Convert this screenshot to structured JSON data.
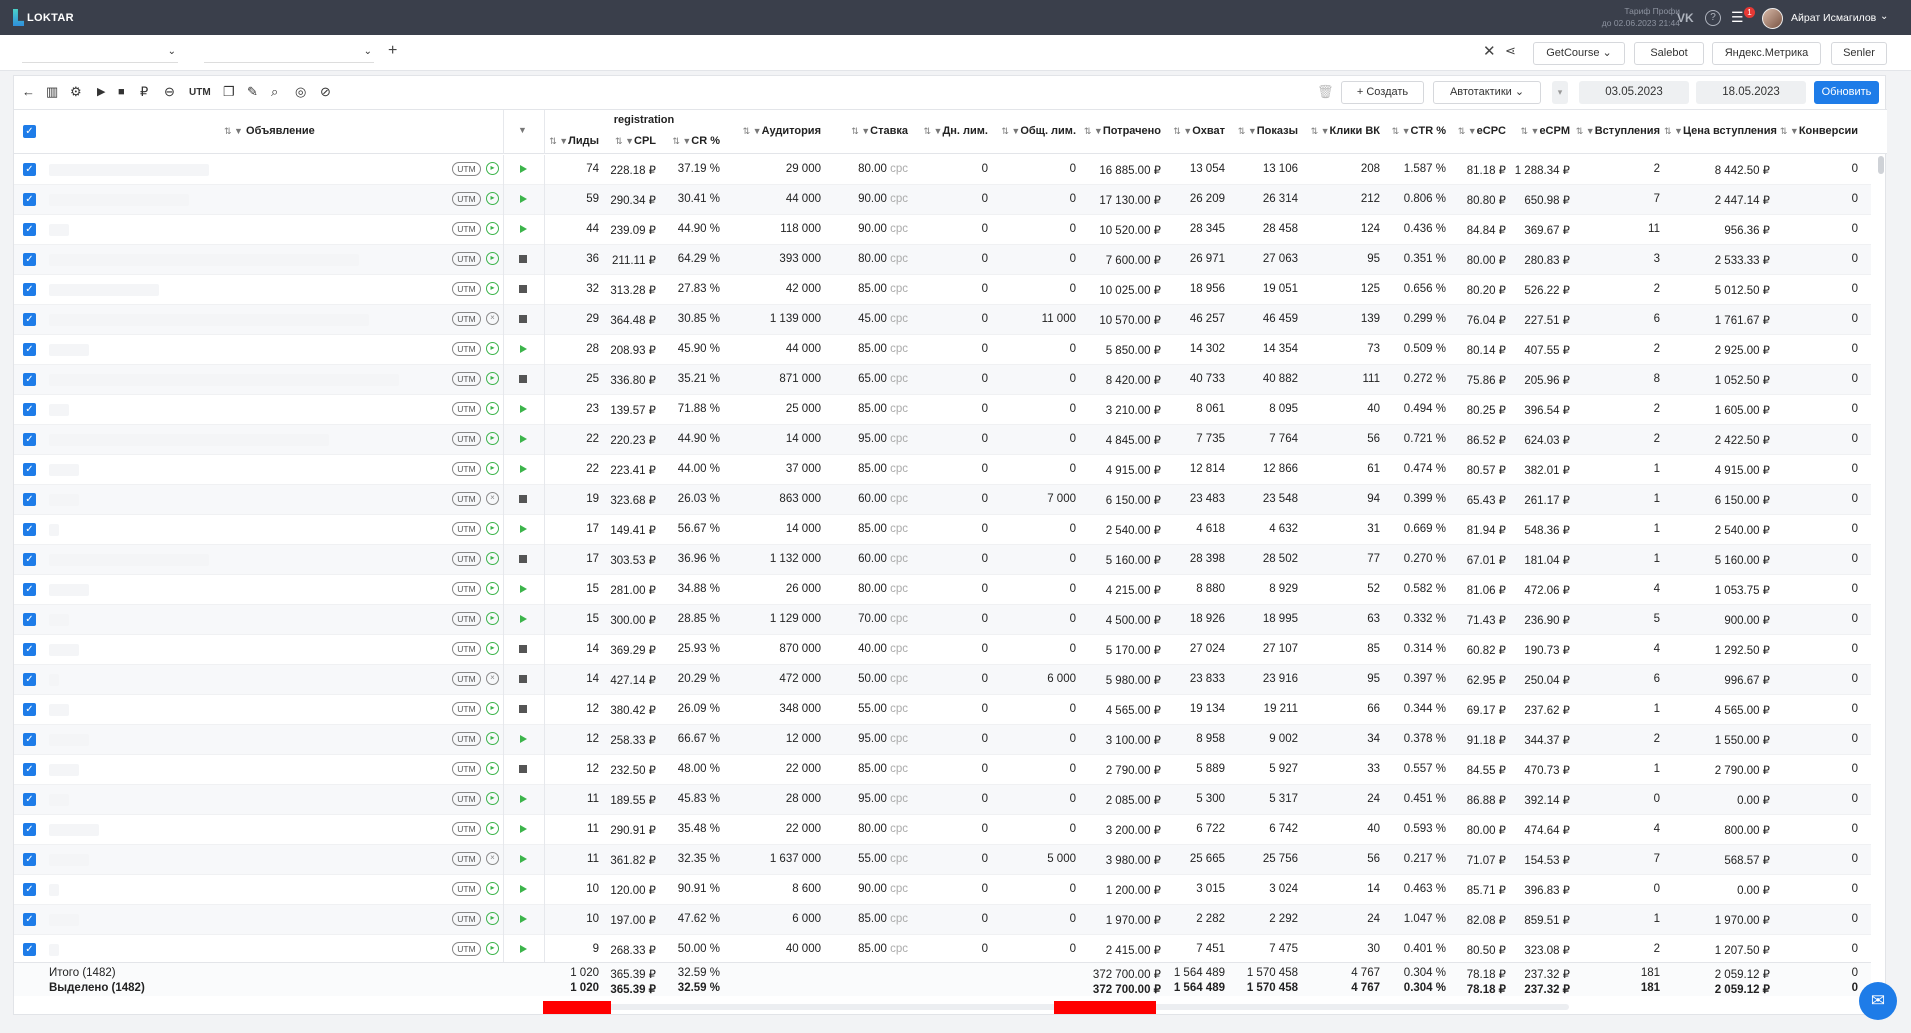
{
  "brand": {
    "logo_text": "LOKTAR"
  },
  "top": {
    "tariff_line1": "Тариф Профи",
    "tariff_line2": "до 02.06.2023 21:44",
    "notif_count": "1",
    "username": "Айрат Исмагилов"
  },
  "integrations": [
    "GetCourse",
    "Salebot",
    "Яндекс.Метрика",
    "Senler"
  ],
  "toolbar": {
    "utm_label": "UTM",
    "create_label": "Создать",
    "autotactics_label": "Автотактики",
    "date_from": "03.05.2023",
    "date_to": "18.05.2023",
    "refresh_label": "Обновить"
  },
  "columns": {
    "ad": "Объявление",
    "group": "registration",
    "leads": "Лиды",
    "cpl": "CPL",
    "cr": "CR %",
    "audience": "Аудитория",
    "rate": "Ставка",
    "day_lim": "Дн. лим.",
    "total_lim": "Общ. лим.",
    "spent": "Потрачено",
    "reach": "Охват",
    "impressions": "Показы",
    "clicks": "Клики ВК",
    "ctr": "CTR %",
    "ecpc": "eCPC",
    "ecpm": "eCPM",
    "joins": "Вступления",
    "join_price": "Цена вступления",
    "conv": "Конверсии"
  },
  "rows": [
    {
      "status": "on",
      "run": "play",
      "leads": "74",
      "cpl": "228.18 ₽",
      "cr": "37.19 %",
      "audience": "29 000",
      "rate": "80.00",
      "day_lim": "0",
      "total_lim": "0",
      "spent": "16 885.00 ₽",
      "reach": "13 054",
      "impressions": "13 106",
      "clicks": "208",
      "ctr": "1.587 %",
      "ecpc": "81.18 ₽",
      "ecpm": "1 288.34 ₽",
      "joins": "2",
      "join_price": "8 442.50 ₽",
      "conv": "0"
    },
    {
      "status": "on",
      "run": "play",
      "leads": "59",
      "cpl": "290.34 ₽",
      "cr": "30.41 %",
      "audience": "44 000",
      "rate": "90.00",
      "day_lim": "0",
      "total_lim": "0",
      "spent": "17 130.00 ₽",
      "reach": "26 209",
      "impressions": "26 314",
      "clicks": "212",
      "ctr": "0.806 %",
      "ecpc": "80.80 ₽",
      "ecpm": "650.98 ₽",
      "joins": "7",
      "join_price": "2 447.14 ₽",
      "conv": "0"
    },
    {
      "status": "on",
      "run": "play",
      "leads": "44",
      "cpl": "239.09 ₽",
      "cr": "44.90 %",
      "audience": "118 000",
      "rate": "90.00",
      "day_lim": "0",
      "total_lim": "0",
      "spent": "10 520.00 ₽",
      "reach": "28 345",
      "impressions": "28 458",
      "clicks": "124",
      "ctr": "0.436 %",
      "ecpc": "84.84 ₽",
      "ecpm": "369.67 ₽",
      "joins": "11",
      "join_price": "956.36 ₽",
      "conv": "0"
    },
    {
      "status": "on",
      "run": "stop",
      "leads": "36",
      "cpl": "211.11 ₽",
      "cr": "64.29 %",
      "audience": "393 000",
      "rate": "80.00",
      "day_lim": "0",
      "total_lim": "0",
      "spent": "7 600.00 ₽",
      "reach": "26 971",
      "impressions": "27 063",
      "clicks": "95",
      "ctr": "0.351 %",
      "ecpc": "80.00 ₽",
      "ecpm": "280.83 ₽",
      "joins": "3",
      "join_price": "2 533.33 ₽",
      "conv": "0"
    },
    {
      "status": "on",
      "run": "stop",
      "leads": "32",
      "cpl": "313.28 ₽",
      "cr": "27.83 %",
      "audience": "42 000",
      "rate": "85.00",
      "day_lim": "0",
      "total_lim": "0",
      "spent": "10 025.00 ₽",
      "reach": "18 956",
      "impressions": "19 051",
      "clicks": "125",
      "ctr": "0.656 %",
      "ecpc": "80.20 ₽",
      "ecpm": "526.22 ₽",
      "joins": "2",
      "join_price": "5 012.50 ₽",
      "conv": "0"
    },
    {
      "status": "off",
      "run": "stop",
      "leads": "29",
      "cpl": "364.48 ₽",
      "cr": "30.85 %",
      "audience": "1 139 000",
      "rate": "45.00",
      "day_lim": "0",
      "total_lim": "11 000",
      "spent": "10 570.00 ₽",
      "reach": "46 257",
      "impressions": "46 459",
      "clicks": "139",
      "ctr": "0.299 %",
      "ecpc": "76.04 ₽",
      "ecpm": "227.51 ₽",
      "joins": "6",
      "join_price": "1 761.67 ₽",
      "conv": "0"
    },
    {
      "status": "on",
      "run": "play",
      "leads": "28",
      "cpl": "208.93 ₽",
      "cr": "45.90 %",
      "audience": "44 000",
      "rate": "85.00",
      "day_lim": "0",
      "total_lim": "0",
      "spent": "5 850.00 ₽",
      "reach": "14 302",
      "impressions": "14 354",
      "clicks": "73",
      "ctr": "0.509 %",
      "ecpc": "80.14 ₽",
      "ecpm": "407.55 ₽",
      "joins": "2",
      "join_price": "2 925.00 ₽",
      "conv": "0"
    },
    {
      "status": "on",
      "run": "stop",
      "leads": "25",
      "cpl": "336.80 ₽",
      "cr": "35.21 %",
      "audience": "871 000",
      "rate": "65.00",
      "day_lim": "0",
      "total_lim": "0",
      "spent": "8 420.00 ₽",
      "reach": "40 733",
      "impressions": "40 882",
      "clicks": "111",
      "ctr": "0.272 %",
      "ecpc": "75.86 ₽",
      "ecpm": "205.96 ₽",
      "joins": "8",
      "join_price": "1 052.50 ₽",
      "conv": "0"
    },
    {
      "status": "on",
      "run": "play",
      "leads": "23",
      "cpl": "139.57 ₽",
      "cr": "71.88 %",
      "audience": "25 000",
      "rate": "85.00",
      "day_lim": "0",
      "total_lim": "0",
      "spent": "3 210.00 ₽",
      "reach": "8 061",
      "impressions": "8 095",
      "clicks": "40",
      "ctr": "0.494 %",
      "ecpc": "80.25 ₽",
      "ecpm": "396.54 ₽",
      "joins": "2",
      "join_price": "1 605.00 ₽",
      "conv": "0"
    },
    {
      "status": "on",
      "run": "play",
      "leads": "22",
      "cpl": "220.23 ₽",
      "cr": "44.90 %",
      "audience": "14 000",
      "rate": "95.00",
      "day_lim": "0",
      "total_lim": "0",
      "spent": "4 845.00 ₽",
      "reach": "7 735",
      "impressions": "7 764",
      "clicks": "56",
      "ctr": "0.721 %",
      "ecpc": "86.52 ₽",
      "ecpm": "624.03 ₽",
      "joins": "2",
      "join_price": "2 422.50 ₽",
      "conv": "0"
    },
    {
      "status": "on",
      "run": "play",
      "leads": "22",
      "cpl": "223.41 ₽",
      "cr": "44.00 %",
      "audience": "37 000",
      "rate": "85.00",
      "day_lim": "0",
      "total_lim": "0",
      "spent": "4 915.00 ₽",
      "reach": "12 814",
      "impressions": "12 866",
      "clicks": "61",
      "ctr": "0.474 %",
      "ecpc": "80.57 ₽",
      "ecpm": "382.01 ₽",
      "joins": "1",
      "join_price": "4 915.00 ₽",
      "conv": "0"
    },
    {
      "status": "off",
      "run": "stop",
      "leads": "19",
      "cpl": "323.68 ₽",
      "cr": "26.03 %",
      "audience": "863 000",
      "rate": "60.00",
      "day_lim": "0",
      "total_lim": "7 000",
      "spent": "6 150.00 ₽",
      "reach": "23 483",
      "impressions": "23 548",
      "clicks": "94",
      "ctr": "0.399 %",
      "ecpc": "65.43 ₽",
      "ecpm": "261.17 ₽",
      "joins": "1",
      "join_price": "6 150.00 ₽",
      "conv": "0"
    },
    {
      "status": "on",
      "run": "play",
      "leads": "17",
      "cpl": "149.41 ₽",
      "cr": "56.67 %",
      "audience": "14 000",
      "rate": "85.00",
      "day_lim": "0",
      "total_lim": "0",
      "spent": "2 540.00 ₽",
      "reach": "4 618",
      "impressions": "4 632",
      "clicks": "31",
      "ctr": "0.669 %",
      "ecpc": "81.94 ₽",
      "ecpm": "548.36 ₽",
      "joins": "1",
      "join_price": "2 540.00 ₽",
      "conv": "0"
    },
    {
      "status": "on",
      "run": "stop",
      "leads": "17",
      "cpl": "303.53 ₽",
      "cr": "36.96 %",
      "audience": "1 132 000",
      "rate": "60.00",
      "day_lim": "0",
      "total_lim": "0",
      "spent": "5 160.00 ₽",
      "reach": "28 398",
      "impressions": "28 502",
      "clicks": "77",
      "ctr": "0.270 %",
      "ecpc": "67.01 ₽",
      "ecpm": "181.04 ₽",
      "joins": "1",
      "join_price": "5 160.00 ₽",
      "conv": "0"
    },
    {
      "status": "on",
      "run": "play",
      "leads": "15",
      "cpl": "281.00 ₽",
      "cr": "34.88 %",
      "audience": "26 000",
      "rate": "80.00",
      "day_lim": "0",
      "total_lim": "0",
      "spent": "4 215.00 ₽",
      "reach": "8 880",
      "impressions": "8 929",
      "clicks": "52",
      "ctr": "0.582 %",
      "ecpc": "81.06 ₽",
      "ecpm": "472.06 ₽",
      "joins": "4",
      "join_price": "1 053.75 ₽",
      "conv": "0"
    },
    {
      "status": "on",
      "run": "play",
      "leads": "15",
      "cpl": "300.00 ₽",
      "cr": "28.85 %",
      "audience": "1 129 000",
      "rate": "70.00",
      "day_lim": "0",
      "total_lim": "0",
      "spent": "4 500.00 ₽",
      "reach": "18 926",
      "impressions": "18 995",
      "clicks": "63",
      "ctr": "0.332 %",
      "ecpc": "71.43 ₽",
      "ecpm": "236.90 ₽",
      "joins": "5",
      "join_price": "900.00 ₽",
      "conv": "0"
    },
    {
      "status": "on",
      "run": "stop",
      "leads": "14",
      "cpl": "369.29 ₽",
      "cr": "25.93 %",
      "audience": "870 000",
      "rate": "40.00",
      "day_lim": "0",
      "total_lim": "0",
      "spent": "5 170.00 ₽",
      "reach": "27 024",
      "impressions": "27 107",
      "clicks": "85",
      "ctr": "0.314 %",
      "ecpc": "60.82 ₽",
      "ecpm": "190.73 ₽",
      "joins": "4",
      "join_price": "1 292.50 ₽",
      "conv": "0"
    },
    {
      "status": "off",
      "run": "stop",
      "leads": "14",
      "cpl": "427.14 ₽",
      "cr": "20.29 %",
      "audience": "472 000",
      "rate": "50.00",
      "day_lim": "0",
      "total_lim": "6 000",
      "spent": "5 980.00 ₽",
      "reach": "23 833",
      "impressions": "23 916",
      "clicks": "95",
      "ctr": "0.397 %",
      "ecpc": "62.95 ₽",
      "ecpm": "250.04 ₽",
      "joins": "6",
      "join_price": "996.67 ₽",
      "conv": "0"
    },
    {
      "status": "on",
      "run": "stop",
      "leads": "12",
      "cpl": "380.42 ₽",
      "cr": "26.09 %",
      "audience": "348 000",
      "rate": "55.00",
      "day_lim": "0",
      "total_lim": "0",
      "spent": "4 565.00 ₽",
      "reach": "19 134",
      "impressions": "19 211",
      "clicks": "66",
      "ctr": "0.344 %",
      "ecpc": "69.17 ₽",
      "ecpm": "237.62 ₽",
      "joins": "1",
      "join_price": "4 565.00 ₽",
      "conv": "0"
    },
    {
      "status": "on",
      "run": "play",
      "leads": "12",
      "cpl": "258.33 ₽",
      "cr": "66.67 %",
      "audience": "12 000",
      "rate": "95.00",
      "day_lim": "0",
      "total_lim": "0",
      "spent": "3 100.00 ₽",
      "reach": "8 958",
      "impressions": "9 002",
      "clicks": "34",
      "ctr": "0.378 %",
      "ecpc": "91.18 ₽",
      "ecpm": "344.37 ₽",
      "joins": "2",
      "join_price": "1 550.00 ₽",
      "conv": "0"
    },
    {
      "status": "on",
      "run": "stop",
      "leads": "12",
      "cpl": "232.50 ₽",
      "cr": "48.00 %",
      "audience": "22 000",
      "rate": "85.00",
      "day_lim": "0",
      "total_lim": "0",
      "spent": "2 790.00 ₽",
      "reach": "5 889",
      "impressions": "5 927",
      "clicks": "33",
      "ctr": "0.557 %",
      "ecpc": "84.55 ₽",
      "ecpm": "470.73 ₽",
      "joins": "1",
      "join_price": "2 790.00 ₽",
      "conv": "0"
    },
    {
      "status": "on",
      "run": "play",
      "leads": "11",
      "cpl": "189.55 ₽",
      "cr": "45.83 %",
      "audience": "28 000",
      "rate": "95.00",
      "day_lim": "0",
      "total_lim": "0",
      "spent": "2 085.00 ₽",
      "reach": "5 300",
      "impressions": "5 317",
      "clicks": "24",
      "ctr": "0.451 %",
      "ecpc": "86.88 ₽",
      "ecpm": "392.14 ₽",
      "joins": "0",
      "join_price": "0.00 ₽",
      "conv": "0"
    },
    {
      "status": "on",
      "run": "play",
      "leads": "11",
      "cpl": "290.91 ₽",
      "cr": "35.48 %",
      "audience": "22 000",
      "rate": "80.00",
      "day_lim": "0",
      "total_lim": "0",
      "spent": "3 200.00 ₽",
      "reach": "6 722",
      "impressions": "6 742",
      "clicks": "40",
      "ctr": "0.593 %",
      "ecpc": "80.00 ₽",
      "ecpm": "474.64 ₽",
      "joins": "4",
      "join_price": "800.00 ₽",
      "conv": "0"
    },
    {
      "status": "off",
      "run": "play",
      "leads": "11",
      "cpl": "361.82 ₽",
      "cr": "32.35 %",
      "audience": "1 637 000",
      "rate": "55.00",
      "day_lim": "0",
      "total_lim": "5 000",
      "spent": "3 980.00 ₽",
      "reach": "25 665",
      "impressions": "25 756",
      "clicks": "56",
      "ctr": "0.217 %",
      "ecpc": "71.07 ₽",
      "ecpm": "154.53 ₽",
      "joins": "7",
      "join_price": "568.57 ₽",
      "conv": "0"
    },
    {
      "status": "on",
      "run": "play",
      "leads": "10",
      "cpl": "120.00 ₽",
      "cr": "90.91 %",
      "audience": "8 600",
      "rate": "90.00",
      "day_lim": "0",
      "total_lim": "0",
      "spent": "1 200.00 ₽",
      "reach": "3 015",
      "impressions": "3 024",
      "clicks": "14",
      "ctr": "0.463 %",
      "ecpc": "85.71 ₽",
      "ecpm": "396.83 ₽",
      "joins": "0",
      "join_price": "0.00 ₽",
      "conv": "0"
    },
    {
      "status": "on",
      "run": "play",
      "leads": "10",
      "cpl": "197.00 ₽",
      "cr": "47.62 %",
      "audience": "6 000",
      "rate": "85.00",
      "day_lim": "0",
      "total_lim": "0",
      "spent": "1 970.00 ₽",
      "reach": "2 282",
      "impressions": "2 292",
      "clicks": "24",
      "ctr": "1.047 %",
      "ecpc": "82.08 ₽",
      "ecpm": "859.51 ₽",
      "joins": "1",
      "join_price": "1 970.00 ₽",
      "conv": "0"
    },
    {
      "status": "on",
      "run": "play",
      "leads": "9",
      "cpl": "268.33 ₽",
      "cr": "50.00 %",
      "audience": "40 000",
      "rate": "85.00",
      "day_lim": "0",
      "total_lim": "0",
      "spent": "2 415.00 ₽",
      "reach": "7 451",
      "impressions": "7 475",
      "clicks": "30",
      "ctr": "0.401 %",
      "ecpc": "80.50 ₽",
      "ecpm": "323.08 ₽",
      "joins": "2",
      "join_price": "1 207.50 ₽",
      "conv": "0"
    }
  ],
  "rate_suffix": "срс",
  "totals": {
    "label": "Итого (1482)",
    "leads": "1 020",
    "cpl": "365.39 ₽",
    "cr": "32.59 %",
    "spent": "372 700.00 ₽",
    "reach": "1 564 489",
    "impressions": "1 570 458",
    "clicks": "4 767",
    "ctr": "0.304 %",
    "ecpc": "78.18 ₽",
    "ecpm": "237.32 ₽",
    "joins": "181",
    "join_price": "2 059.12 ₽",
    "conv": "0"
  },
  "selected": {
    "label": "Выделено (1482)",
    "leads": "1 020",
    "cpl": "365.39 ₽",
    "cr": "32.59 %",
    "spent": "372 700.00 ₽",
    "reach": "1 564 489",
    "impressions": "1 570 458",
    "clicks": "4 767",
    "ctr": "0.304 %",
    "ecpc": "78.18 ₽",
    "ecpm": "237.32 ₽",
    "joins": "181",
    "join_price": "2 059.12 ₽",
    "conv": "0"
  }
}
